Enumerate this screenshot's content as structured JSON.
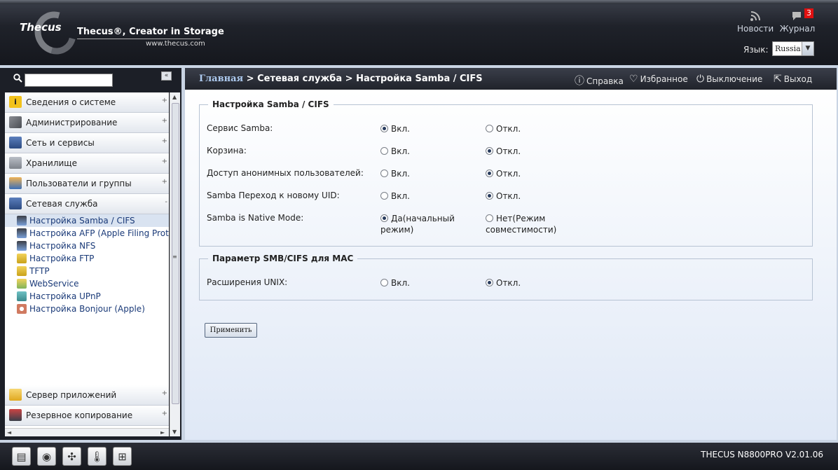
{
  "header": {
    "brand": "Thecus",
    "tagline": "Thecus®, Creator in Storage",
    "url": "www.thecus.com",
    "news_label": "Новости",
    "log_label": "Журнал",
    "log_count": "3",
    "language_label": "Язык:",
    "language_value": "Russia"
  },
  "sidebar": {
    "search_placeholder": "",
    "items": [
      {
        "label": "Сведения о системе"
      },
      {
        "label": "Администрирование"
      },
      {
        "label": "Сеть и сервисы"
      },
      {
        "label": "Хранилище"
      },
      {
        "label": "Пользователи и группы"
      },
      {
        "label": "Сетевая служба"
      }
    ],
    "subitems": [
      {
        "label": "Настройка Samba / CIFS"
      },
      {
        "label": "Настройка AFP (Apple Filing Protocol)"
      },
      {
        "label": "Настройка NFS"
      },
      {
        "label": "Настройка FTP"
      },
      {
        "label": "TFTP"
      },
      {
        "label": "WebService"
      },
      {
        "label": "Настройка UPnP"
      },
      {
        "label": "Настройка Bonjour (Apple)"
      }
    ],
    "bottom_items": [
      {
        "label": "Сервер приложений"
      },
      {
        "label": "Резервное копирование"
      }
    ]
  },
  "toolbar": {
    "breadcrumb_home": "Главная",
    "breadcrumb_rest": " > Сетевая служба > Настройка Samba / CIFS",
    "help": "Справка",
    "favorites": "Избранное",
    "shutdown": "Выключение",
    "logout": "Выход"
  },
  "samba": {
    "legend": "Настройка Samba / CIFS",
    "rows": [
      {
        "label": "Сервис Samba:",
        "on": "Вкл.",
        "off": "Откл.",
        "selected": "on"
      },
      {
        "label": "Корзина:",
        "on": "Вкл.",
        "off": "Откл.",
        "selected": "off"
      },
      {
        "label": "Доступ анонимных пользователей:",
        "on": "Вкл.",
        "off": "Откл.",
        "selected": "off"
      },
      {
        "label": "Samba Переход к новому UID:",
        "on": "Вкл.",
        "off": "Откл.",
        "selected": "off"
      },
      {
        "label": "Samba is Native Mode:",
        "on": "Да(начальный режим)",
        "off": "Нет(Режим совместимости)",
        "selected": "on"
      }
    ]
  },
  "mac": {
    "legend": "Параметр SMB/CIFS для MAC",
    "rows": [
      {
        "label": "Расширения UNIX:",
        "on": "Вкл.",
        "off": "Откл.",
        "selected": "off"
      }
    ]
  },
  "apply_label": "Применить",
  "footer": {
    "version": "THECUS N8800PRO V2.01.06"
  }
}
